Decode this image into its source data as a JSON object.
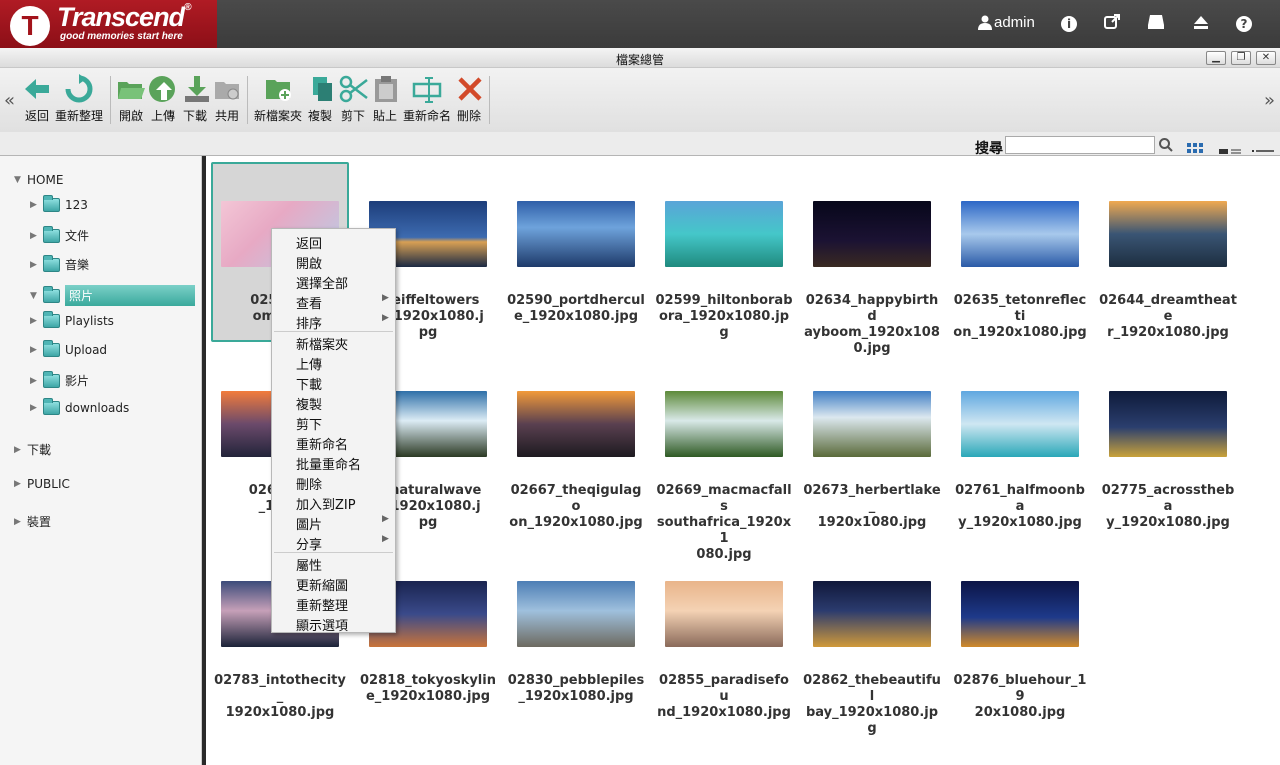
{
  "header": {
    "brand": "Transcend",
    "tagline": "good memories start here",
    "user": "admin"
  },
  "window": {
    "title": "檔案總管"
  },
  "toolbar": {
    "buttons": [
      {
        "label": "返回",
        "icon": "back-arrow-icon"
      },
      {
        "label": "重新整理",
        "icon": "refresh-icon"
      },
      {
        "label": "開啟",
        "icon": "open-folder-icon"
      },
      {
        "label": "上傳",
        "icon": "upload-icon"
      },
      {
        "label": "下載",
        "icon": "download-icon"
      },
      {
        "label": "共用",
        "icon": "share-icon"
      },
      {
        "label": "新檔案夾",
        "icon": "new-folder-icon"
      },
      {
        "label": "複製",
        "icon": "copy-icon"
      },
      {
        "label": "剪下",
        "icon": "scissors-icon"
      },
      {
        "label": "貼上",
        "icon": "paste-icon"
      },
      {
        "label": "重新命名",
        "icon": "rename-icon"
      },
      {
        "label": "刪除",
        "icon": "delete-icon"
      }
    ]
  },
  "search": {
    "label": "搜尋",
    "value": ""
  },
  "sidebar": {
    "home": "HOME",
    "folders": [
      "123",
      "文件",
      "音樂",
      "照片",
      "Playlists",
      "Upload",
      "影片",
      "downloads"
    ],
    "roots": [
      "下載",
      "PUBLIC",
      "裝置"
    ]
  },
  "files": [
    "02555_cherryblossoms_1920x1080.jpg",
    "02581_eiffeltowerset_1920x1080.jpg",
    "02590_portdhercule_1920x1080.jpg",
    "02599_hiltonborabora_1920x1080.jpg",
    "02634_happybirthdayboom_1920x1080.jpg",
    "02635_tetonreflection_1920x1080.jpg",
    "02644_dreamtheater_1920x1080.jpg",
    "02650_ti_1920x1080.jpg",
    "02651_naturalwavek_1920x1080.jpg",
    "02667_theqigulagoon_1920x1080.jpg",
    "02669_macmacfallssouthafrica_1920x1080.jpg",
    "02673_herbertlake_1920x1080.jpg",
    "02761_halfmoonbay_1920x1080.jpg",
    "02775_acrossthebay_1920x1080.jpg",
    "02783_intothecity_1920x1080.jpg",
    "02818_tokyoskyline_1920x1080.jpg",
    "02830_pebblepiles_1920x1080.jpg",
    "02855_paradisefound_1920x1080.jpg",
    "02862_thebeautifulbay_1920x1080.jpg",
    "02876_bluehour_1920x1080.jpg"
  ],
  "labels": {
    "f0": [
      "02555_c",
      "oms_19"
    ],
    "f1": [
      "1_eiffeltowers",
      "et_1920x1080.j",
      "pg"
    ],
    "f2": [
      "02590_portdhercul",
      "e_1920x1080.jpg"
    ],
    "f3": [
      "02599_hiltonborab",
      "ora_1920x1080.jpg"
    ],
    "f4": [
      "02634_happybirthd",
      "ayboom_1920x108",
      "0.jpg"
    ],
    "f5": [
      "02635_tetonreflecti",
      "on_1920x1080.jpg"
    ],
    "f6": [
      "02644_dreamtheate",
      "r_1920x1080.jpg"
    ],
    "f7": [
      "02650_ti",
      "_1920"
    ],
    "f8": [
      "1_naturalwave",
      "k_1920x1080.j",
      "pg"
    ],
    "f9": [
      "02667_theqigulago",
      "on_1920x1080.jpg"
    ],
    "f10": [
      "02669_macmacfalls",
      "southafrica_1920x1",
      "080.jpg"
    ],
    "f11": [
      "02673_herbertlake_",
      "1920x1080.jpg"
    ],
    "f12": [
      "02761_halfmoonba",
      "y_1920x1080.jpg"
    ],
    "f13": [
      "02775_acrossthеba",
      "y_1920x1080.jpg"
    ],
    "f14": [
      "02783_intothecity_",
      "1920x1080.jpg"
    ],
    "f15": [
      "02818_tokyoskylin",
      "e_1920x1080.jpg"
    ],
    "f16": [
      "02830_pebblepiles",
      "_1920x1080.jpg"
    ],
    "f17": [
      "02855_paradisefou",
      "nd_1920x1080.jpg"
    ],
    "f18": [
      "02862_thebeautiful",
      "bay_1920x1080.jpg"
    ],
    "f19": [
      "02876_bluehour_19",
      "20x1080.jpg"
    ]
  },
  "context_menu": {
    "items": [
      "返回",
      "開啟",
      "選擇全部",
      "查看",
      "排序",
      "新檔案夾",
      "上傳",
      "下載",
      "複製",
      "剪下",
      "重新命名",
      "批量重命名",
      "刪除",
      "加入到ZIP",
      "圖片",
      "分享",
      "屬性",
      "更新縮圖",
      "重新整理",
      "顯示選項"
    ]
  },
  "colors": {
    "brand": "#a3131b",
    "accent": "#3aa999"
  }
}
